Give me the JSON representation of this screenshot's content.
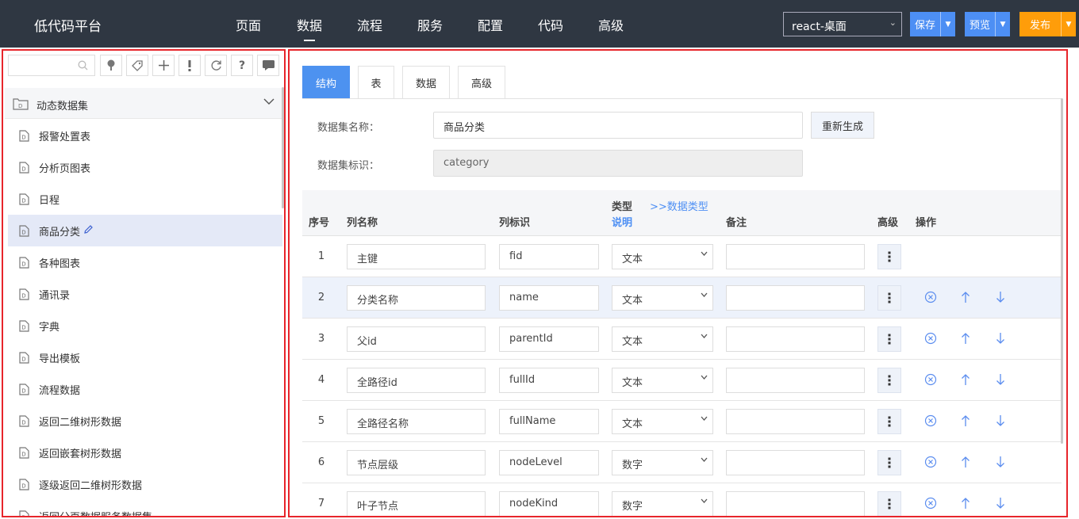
{
  "header": {
    "brand": "低代码平台",
    "nav": [
      "页面",
      "数据",
      "流程",
      "服务",
      "配置",
      "代码",
      "高级"
    ],
    "active_nav": "数据",
    "app_select": "react-桌面",
    "save_label": "保存",
    "preview_label": "预览",
    "publish_label": "发布"
  },
  "sidebar": {
    "search_placeholder": "",
    "toolbar_icons": [
      "tree-icon",
      "tag-icon",
      "plus-icon",
      "exclamation-icon",
      "refresh-icon",
      "help-icon",
      "chat-icon"
    ],
    "group": "动态数据集",
    "items": [
      {
        "label": "报警处置表"
      },
      {
        "label": "分析页图表"
      },
      {
        "label": "日程"
      },
      {
        "label": "商品分类",
        "selected": true
      },
      {
        "label": "各种图表"
      },
      {
        "label": "通讯录"
      },
      {
        "label": "字典"
      },
      {
        "label": "导出模板"
      },
      {
        "label": "流程数据"
      },
      {
        "label": "返回二维树形数据"
      },
      {
        "label": "返回嵌套树形数据"
      },
      {
        "label": "逐级返回二维树形数据"
      },
      {
        "label": "返回分页数据服务数据集"
      }
    ]
  },
  "main": {
    "tabs": [
      "结构",
      "表",
      "数据",
      "高级"
    ],
    "active_tab": "结构",
    "form": {
      "name_label": "数据集名称：",
      "name_value": "商品分类",
      "regen_label": "重新生成",
      "id_label": "数据集标识：",
      "id_value": "category"
    },
    "table": {
      "headers": {
        "no": "序号",
        "col_name": "列名称",
        "col_id": "列标识",
        "type_line1": "类型",
        "type_line2": "说明",
        "type_link": ">>数据类型",
        "remark": "备注",
        "advanced": "高级",
        "actions": "操作"
      },
      "rows": [
        {
          "no": "1",
          "name": "主键",
          "id": "fid",
          "type": "文本",
          "remark": "",
          "actions": false
        },
        {
          "no": "2",
          "name": "分类名称",
          "id": "name",
          "type": "文本",
          "remark": "",
          "actions": true
        },
        {
          "no": "3",
          "name": "父id",
          "id": "parentId",
          "type": "文本",
          "remark": "",
          "actions": true
        },
        {
          "no": "4",
          "name": "全路径id",
          "id": "fullId",
          "type": "文本",
          "remark": "",
          "actions": true
        },
        {
          "no": "5",
          "name": "全路径名称",
          "id": "fullName",
          "type": "文本",
          "remark": "",
          "actions": true
        },
        {
          "no": "6",
          "name": "节点层级",
          "id": "nodeLevel",
          "type": "数字",
          "remark": "",
          "actions": true
        },
        {
          "no": "7",
          "name": "叶子节点",
          "id": "nodeKind",
          "type": "数字",
          "remark": "",
          "actions": true
        }
      ]
    }
  },
  "colors": {
    "topbar": "#2f3742",
    "primary": "#4d8ff4",
    "publish": "#ff9d0a",
    "highlight_border": "#e7252b",
    "selected_item": "#e4e9f7",
    "link": "#4d8ff4"
  }
}
